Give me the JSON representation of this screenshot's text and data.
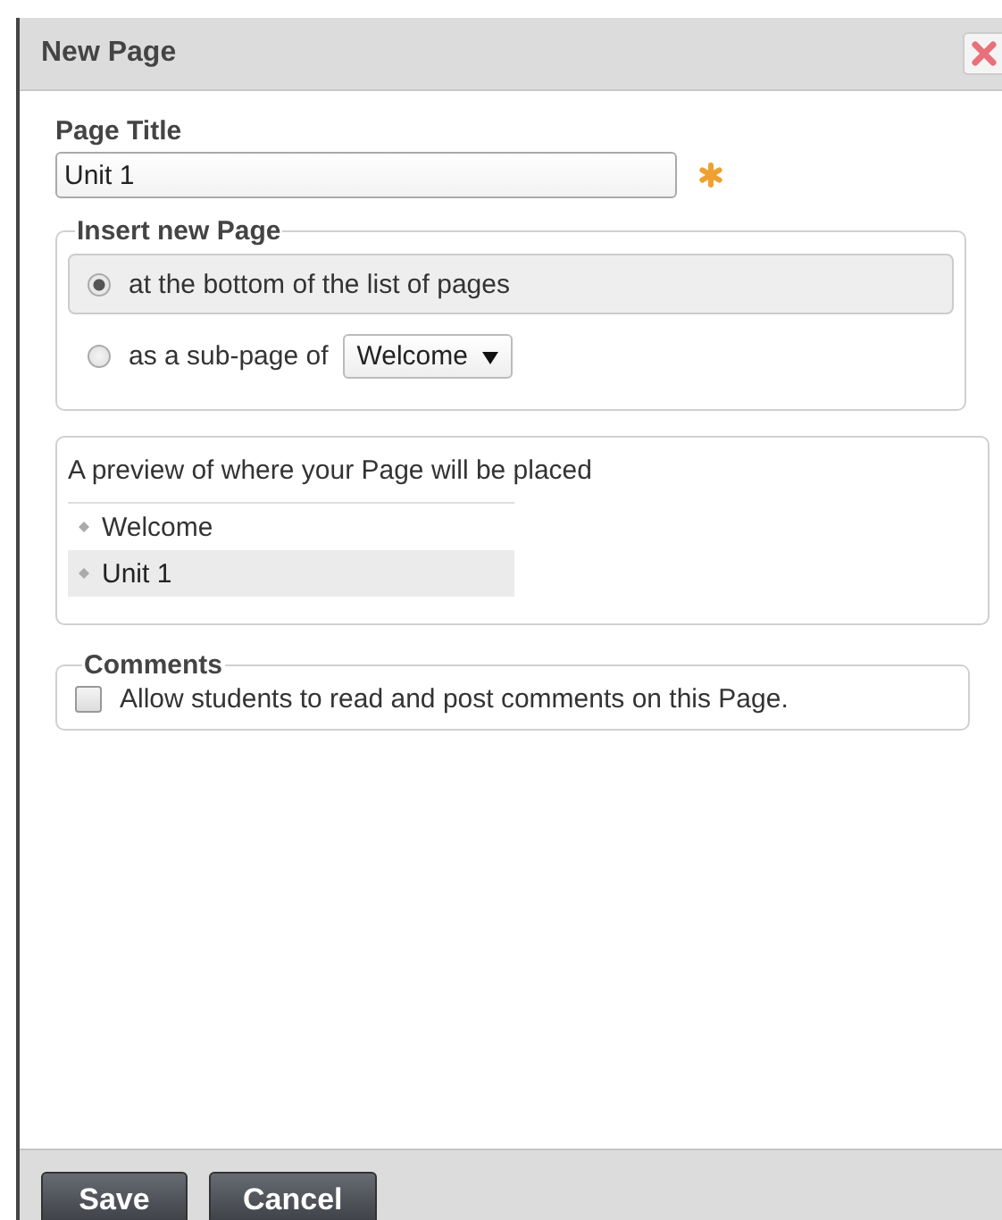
{
  "dialog": {
    "title": "New Page"
  },
  "page_title": {
    "label": "Page Title",
    "value": "Unit 1",
    "required": true
  },
  "insert": {
    "legend": "Insert new Page",
    "options": [
      {
        "kind": "plain",
        "label": "at the bottom of the list of pages",
        "selected": true
      },
      {
        "kind": "select",
        "label": "as a sub-page of",
        "select_value": "Welcome",
        "selected": false
      }
    ]
  },
  "preview": {
    "caption": "A preview of where your Page will be placed",
    "items": [
      {
        "label": "Welcome",
        "selected": false
      },
      {
        "label": "Unit 1",
        "selected": true
      }
    ]
  },
  "comments": {
    "legend": "Comments",
    "label": "Allow students to read and post comments on this Page.",
    "checked": false
  },
  "buttons": [
    "Save",
    "Cancel"
  ]
}
